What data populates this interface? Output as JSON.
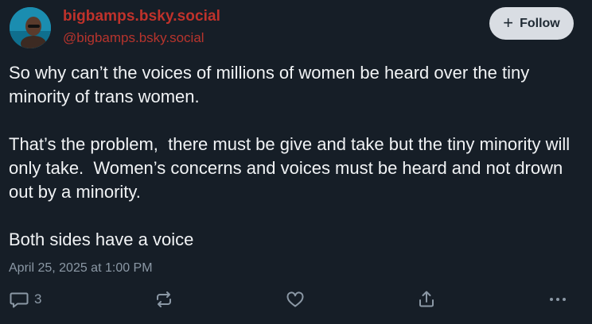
{
  "post": {
    "display_name": "bigbamps.bsky.social",
    "handle": "@bigbamps.bsky.social",
    "follow_label": "Follow",
    "paragraphs": [
      "So why can’t the voices of millions of women be heard over the tiny minority of trans women.",
      "That’s the problem,  there must be give and take but the tiny minority will only take.  Women’s concerns and voices must be heard and not drown out by a minority.",
      "Both sides have a voice"
    ],
    "timestamp": "April 25, 2025 at 1:00 PM",
    "reply_count": "3"
  },
  "icons": {
    "follow": "plus-icon",
    "reply": "reply-bubble-icon",
    "repost": "repost-icon",
    "like": "heart-icon",
    "share": "share-icon",
    "more": "more-horizontal-icon"
  },
  "colors": {
    "background": "#161e27",
    "name_accent": "#c0322b",
    "text": "#f1f3f5",
    "muted": "#8b98a5",
    "follow_bg": "#d9dde3"
  }
}
